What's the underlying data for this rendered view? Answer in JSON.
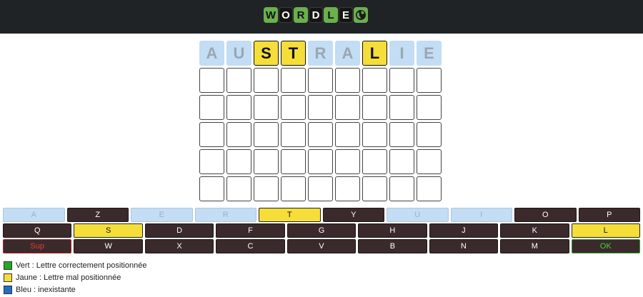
{
  "colors": {
    "header_bg": "#202326",
    "green": "#6ab04c",
    "yellow": "#f5de3a",
    "blue": "#c2ddf4",
    "key_dark": "#3b2a2b",
    "legend_green": "#22aa22",
    "legend_blue": "#1f6fbf"
  },
  "header": {
    "logo_letters": [
      {
        "letter": "W",
        "style": "green"
      },
      {
        "letter": "O",
        "style": "black"
      },
      {
        "letter": "R",
        "style": "green"
      },
      {
        "letter": "D",
        "style": "black"
      },
      {
        "letter": "L",
        "style": "green"
      },
      {
        "letter": "E",
        "style": "black"
      }
    ],
    "logo_icon": "globe-icon"
  },
  "board": {
    "rows": [
      [
        {
          "letter": "A",
          "state": "blue"
        },
        {
          "letter": "U",
          "state": "blue"
        },
        {
          "letter": "S",
          "state": "yellow"
        },
        {
          "letter": "T",
          "state": "yellow"
        },
        {
          "letter": "R",
          "state": "blue"
        },
        {
          "letter": "A",
          "state": "blue"
        },
        {
          "letter": "L",
          "state": "yellow"
        },
        {
          "letter": "I",
          "state": "blue"
        },
        {
          "letter": "E",
          "state": "blue"
        }
      ],
      [
        {
          "letter": "",
          "state": "empty"
        },
        {
          "letter": "",
          "state": "empty"
        },
        {
          "letter": "",
          "state": "empty"
        },
        {
          "letter": "",
          "state": "empty"
        },
        {
          "letter": "",
          "state": "empty"
        },
        {
          "letter": "",
          "state": "empty"
        },
        {
          "letter": "",
          "state": "empty"
        },
        {
          "letter": "",
          "state": "empty"
        },
        {
          "letter": "",
          "state": "empty"
        }
      ],
      [
        {
          "letter": "",
          "state": "empty"
        },
        {
          "letter": "",
          "state": "empty"
        },
        {
          "letter": "",
          "state": "empty"
        },
        {
          "letter": "",
          "state": "empty"
        },
        {
          "letter": "",
          "state": "empty"
        },
        {
          "letter": "",
          "state": "empty"
        },
        {
          "letter": "",
          "state": "empty"
        },
        {
          "letter": "",
          "state": "empty"
        },
        {
          "letter": "",
          "state": "empty"
        }
      ],
      [
        {
          "letter": "",
          "state": "empty"
        },
        {
          "letter": "",
          "state": "empty"
        },
        {
          "letter": "",
          "state": "empty"
        },
        {
          "letter": "",
          "state": "empty"
        },
        {
          "letter": "",
          "state": "empty"
        },
        {
          "letter": "",
          "state": "empty"
        },
        {
          "letter": "",
          "state": "empty"
        },
        {
          "letter": "",
          "state": "empty"
        },
        {
          "letter": "",
          "state": "empty"
        }
      ],
      [
        {
          "letter": "",
          "state": "empty"
        },
        {
          "letter": "",
          "state": "empty"
        },
        {
          "letter": "",
          "state": "empty"
        },
        {
          "letter": "",
          "state": "empty"
        },
        {
          "letter": "",
          "state": "empty"
        },
        {
          "letter": "",
          "state": "empty"
        },
        {
          "letter": "",
          "state": "empty"
        },
        {
          "letter": "",
          "state": "empty"
        },
        {
          "letter": "",
          "state": "empty"
        }
      ],
      [
        {
          "letter": "",
          "state": "empty"
        },
        {
          "letter": "",
          "state": "empty"
        },
        {
          "letter": "",
          "state": "empty"
        },
        {
          "letter": "",
          "state": "empty"
        },
        {
          "letter": "",
          "state": "empty"
        },
        {
          "letter": "",
          "state": "empty"
        },
        {
          "letter": "",
          "state": "empty"
        },
        {
          "letter": "",
          "state": "empty"
        },
        {
          "letter": "",
          "state": "empty"
        }
      ]
    ]
  },
  "keyboard": {
    "rows": [
      [
        {
          "label": "A",
          "state": "blue"
        },
        {
          "label": "Z",
          "state": "dark"
        },
        {
          "label": "E",
          "state": "blue"
        },
        {
          "label": "R",
          "state": "blue"
        },
        {
          "label": "T",
          "state": "yellow"
        },
        {
          "label": "Y",
          "state": "dark"
        },
        {
          "label": "U",
          "state": "blue"
        },
        {
          "label": "I",
          "state": "blue"
        },
        {
          "label": "O",
          "state": "dark"
        },
        {
          "label": "P",
          "state": "dark"
        }
      ],
      [
        {
          "label": "Q",
          "state": "dark"
        },
        {
          "label": "S",
          "state": "yellow"
        },
        {
          "label": "D",
          "state": "dark"
        },
        {
          "label": "F",
          "state": "dark"
        },
        {
          "label": "G",
          "state": "dark"
        },
        {
          "label": "H",
          "state": "dark"
        },
        {
          "label": "J",
          "state": "dark"
        },
        {
          "label": "K",
          "state": "dark"
        },
        {
          "label": "L",
          "state": "yellow"
        }
      ],
      [
        {
          "label": "Sup",
          "state": "sup"
        },
        {
          "label": "W",
          "state": "dark"
        },
        {
          "label": "X",
          "state": "dark"
        },
        {
          "label": "C",
          "state": "dark"
        },
        {
          "label": "V",
          "state": "dark"
        },
        {
          "label": "B",
          "state": "dark"
        },
        {
          "label": "N",
          "state": "dark"
        },
        {
          "label": "M",
          "state": "dark"
        },
        {
          "label": "OK",
          "state": "ok"
        }
      ]
    ]
  },
  "legend": [
    {
      "color": "#22aa22",
      "text": "Vert : Lettre correctement positionnée"
    },
    {
      "color": "#f5de3a",
      "text": "Jaune : Lettre mal positionnée"
    },
    {
      "color": "#1f6fbf",
      "text": "Bleu : inexistante"
    }
  ]
}
